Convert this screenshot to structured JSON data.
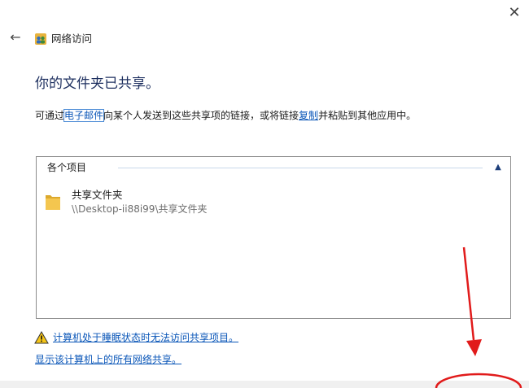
{
  "window": {
    "title": "网络访问",
    "close_glyph": "✕",
    "back_glyph": "←"
  },
  "main": {
    "heading": "你的文件夹已共享。",
    "description": {
      "part1": "可通过",
      "email_link": "电子邮件",
      "part2": "向某个人发送到这些共享项的链接，或将链接",
      "copy_link": "复制",
      "part3": "并粘贴到其他应用中。"
    }
  },
  "items_panel": {
    "header": "各个项目",
    "collapse_glyph": "▲",
    "items": [
      {
        "name": "共享文件夹",
        "path": "\\\\Desktop-ii88i99\\共享文件夹"
      }
    ]
  },
  "footer": {
    "warning_link": "计算机处于睡眠状态时无法访问共享项目。",
    "show_shares_link": "显示该计算机上的所有网络共享。"
  },
  "colors": {
    "link": "#0a56b8",
    "heading": "#1d2f5f",
    "annotation": "#e11b1b"
  },
  "icons": {
    "app": "network-share-icon",
    "folder": "folder-icon",
    "warning": "warning-icon"
  }
}
